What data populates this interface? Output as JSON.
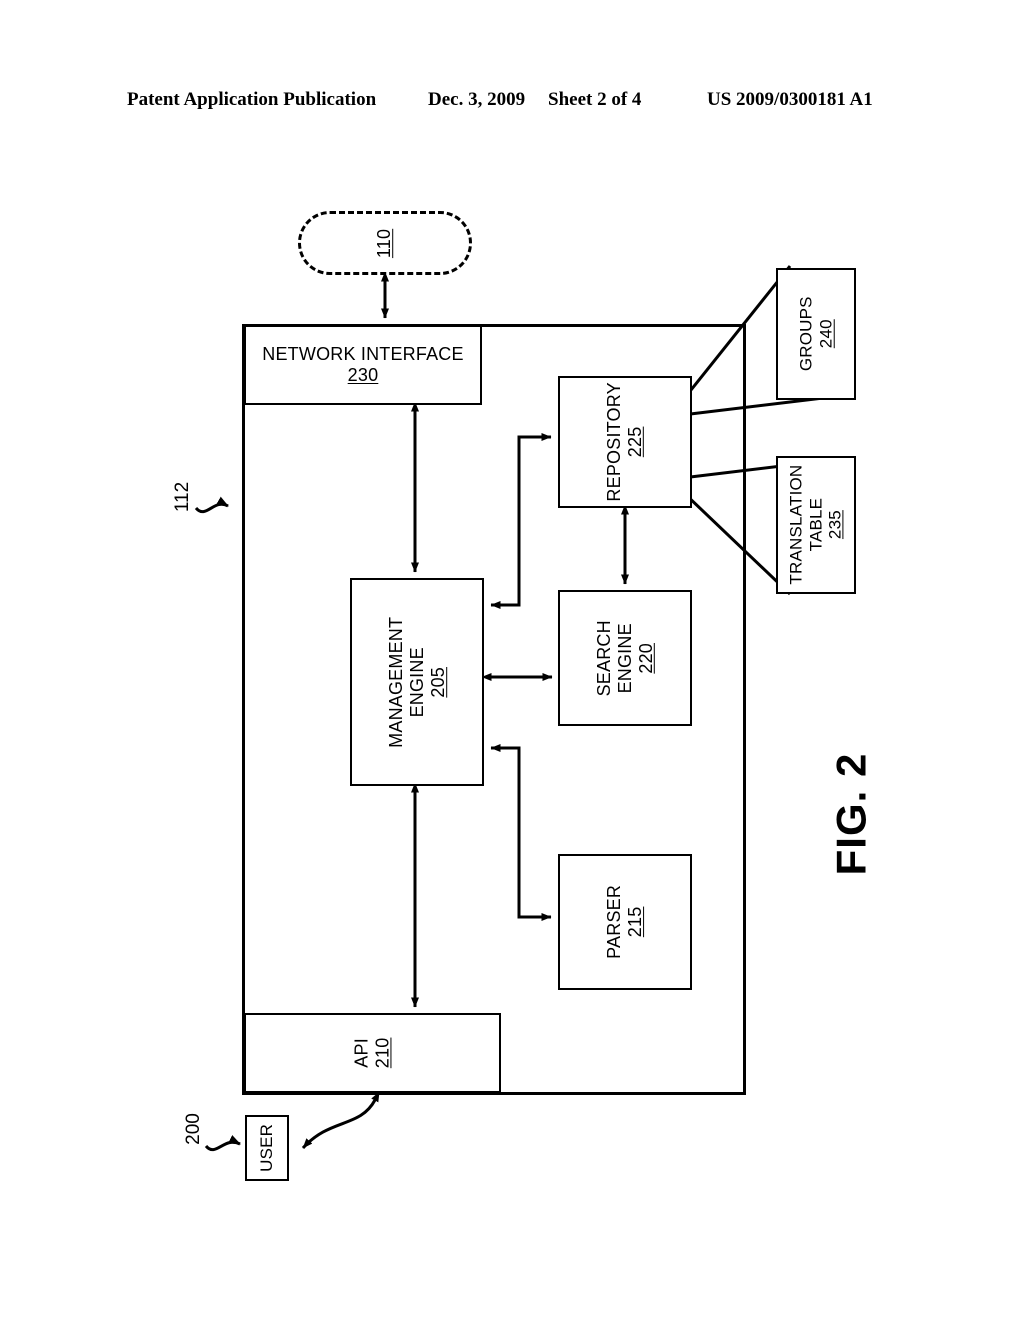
{
  "header": {
    "publication": "Patent Application Publication",
    "date": "Dec. 3, 2009",
    "sheet": "Sheet 2 of 4",
    "document_number": "US 2009/0300181 A1"
  },
  "figure": {
    "caption": "FIG. 2",
    "system_ref": "112",
    "diagram_ref": "200"
  },
  "nodes": {
    "network_cloud": {
      "label": "",
      "ref": "110"
    },
    "network_interface": {
      "label": "NETWORK INTERFACE",
      "ref": "230"
    },
    "management_engine": {
      "label": "MANAGEMENT\nENGINE",
      "line1": "MANAGEMENT",
      "line2": "ENGINE",
      "ref": "205"
    },
    "repository": {
      "label": "REPOSITORY",
      "ref": "225"
    },
    "search_engine": {
      "label": "SEARCH\nENGINE",
      "line1": "SEARCH",
      "line2": "ENGINE",
      "ref": "220"
    },
    "parser": {
      "label": "PARSER",
      "ref": "215"
    },
    "api": {
      "label": "API",
      "ref": "210"
    },
    "groups": {
      "label": "GROUPS",
      "ref": "240"
    },
    "translation_table": {
      "label": "TRANSLATION\nTABLE",
      "line1": "TRANSLATION",
      "line2": "TABLE",
      "ref": "235"
    },
    "user": {
      "label": "USER",
      "ref": ""
    }
  },
  "colors": {
    "ink": "#000000",
    "paper": "#ffffff"
  }
}
